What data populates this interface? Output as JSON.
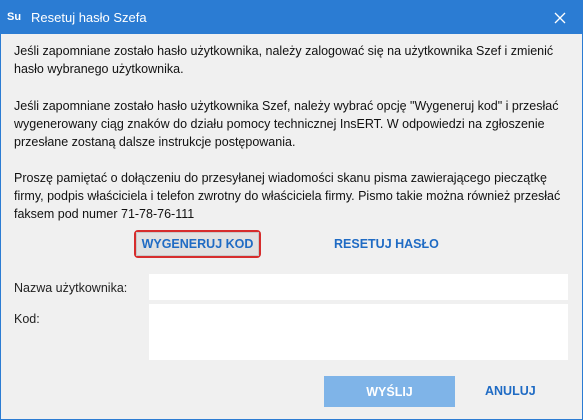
{
  "window": {
    "app_icon_text": "Su",
    "title": "Resetuj hasło Szefa"
  },
  "content": {
    "paragraph1": "Jeśli zapomniane zostało hasło użytkownika, należy zalogować się na użytkownika Szef i zmienić hasło wybranego użytkownika.",
    "paragraph2": "Jeśli zapomniane zostało hasło użytkownika Szef, należy wybrać opcję \"Wygeneruj kod\" i przesłać wygenerowany ciąg znaków do działu pomocy technicznej InsERT. W odpowiedzi na zgłoszenie przesłane zostaną dalsze instrukcje postępowania.",
    "paragraph3": "Proszę pamiętać o dołączeniu do przesyłanej wiadomości skanu pisma zawierającego pieczątkę firmy, podpis właściciela i telefon zwrotny do właściciela firmy. Pismo takie można również przesłać faksem pod numer 71-78-76-111"
  },
  "actions": {
    "generate_label": "WYGENERUJ KOD",
    "reset_label": "RESETUJ HASŁO"
  },
  "form": {
    "username_label": "Nazwa użytkownika:",
    "username_value": "",
    "code_label": "Kod:",
    "code_value": ""
  },
  "footer": {
    "send_label": "WYŚLIJ",
    "cancel_label": "ANULUJ"
  },
  "colors": {
    "titlebar": "#2b7cd3",
    "accent_link": "#1f6bc4",
    "highlight_border": "#d62c2c",
    "send_button_disabled": "#7fb4e8"
  }
}
